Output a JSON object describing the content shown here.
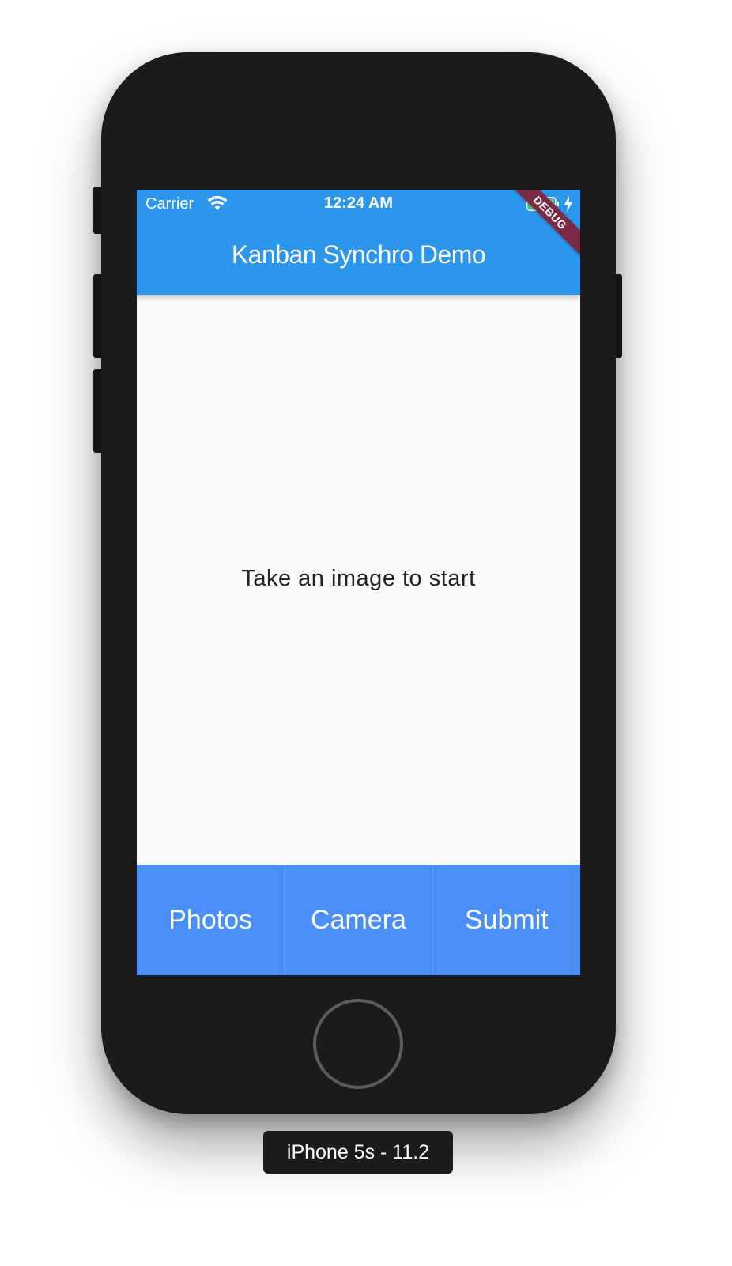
{
  "device": {
    "label": "iPhone 5s - 11.2"
  },
  "status_bar": {
    "carrier": "Carrier",
    "time": "12:24 AM",
    "wifi_icon": "wifi-icon",
    "battery_icon": "battery-charging-icon",
    "battery_color": "#4cd964"
  },
  "app_bar": {
    "title": "Kanban Synchro Demo",
    "color": "#2c96ec",
    "debug_banner": "DEBUG"
  },
  "content": {
    "message": "Take an image to start"
  },
  "bottom_bar": {
    "color": "#4a8ef8",
    "buttons": [
      {
        "label": "Photos"
      },
      {
        "label": "Camera"
      },
      {
        "label": "Submit"
      }
    ]
  }
}
